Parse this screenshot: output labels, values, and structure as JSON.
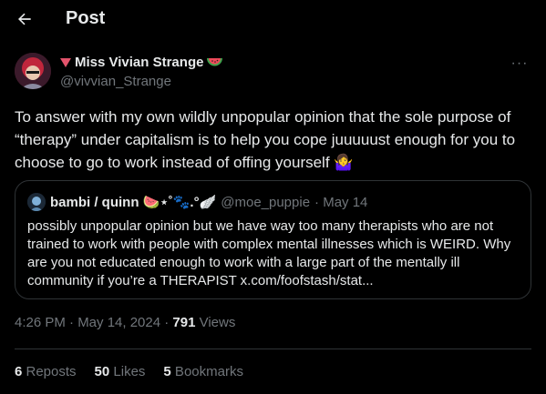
{
  "header": {
    "title": "Post"
  },
  "post": {
    "author_name": "Miss Vivian Strange",
    "handle": "@vivvian_Strange",
    "more": "···",
    "text": "To answer with my own wildly unpopular opinion that the sole purpose of “therapy” under capitalism is to help you cope juuuuust enough for you to choose to go to work instead of offing yourself 🤷‍♀️",
    "timestamp": "4:26 PM · May 14, 2024 · ",
    "views_count": "791",
    "views_label": " Views"
  },
  "quote": {
    "name": "bambi / quinn 🍉⋆˚🐾.°🪽",
    "handle": "@moe_puppie",
    "date": " · May 14",
    "text": "possibly unpopular opinion but we have way too many therapists who are not trained to work with people with complex mental illnesses which is WEIRD. Why are you not educated enough to work with a large part of the mentally ill community if you’re a THERAPIST x.com/foofstash/stat..."
  },
  "stats": {
    "reposts_count": "6",
    "reposts_label": " Reposts",
    "likes_count": "50",
    "likes_label": " Likes",
    "bookmarks_count": "5",
    "bookmarks_label": " Bookmarks"
  },
  "colors": {
    "background": "#000000",
    "text": "#e7e9ea",
    "muted": "#71767b",
    "border": "#2f3336"
  }
}
